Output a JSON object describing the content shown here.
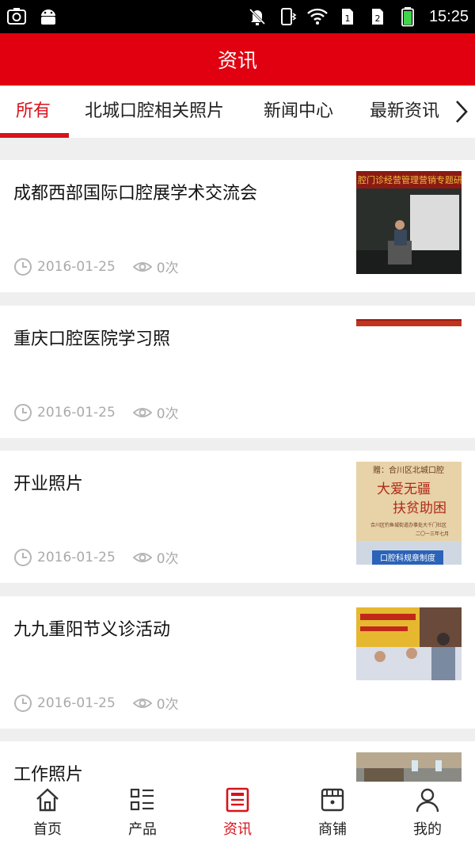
{
  "status_bar": {
    "time": "15:25",
    "icons": [
      "screenshot-icon",
      "android-icon",
      "mute-icon",
      "phone-vibrate-icon",
      "wifi-icon",
      "sim1-icon",
      "sim2-icon",
      "battery-icon"
    ]
  },
  "header": {
    "title": "资讯"
  },
  "tabs": [
    {
      "label": "所有",
      "active": true
    },
    {
      "label": "北城口腔相关照片"
    },
    {
      "label": "新闻中心"
    },
    {
      "label": "最新资讯"
    }
  ],
  "news": [
    {
      "title": "成都西部国际口腔展学术交流会",
      "date": "2016-01-25",
      "views": "0次",
      "thumb": "conference-photo"
    },
    {
      "title": "重庆口腔医院学习照",
      "date": "2016-01-25",
      "views": "0次",
      "thumb": "banner-photo-partial"
    },
    {
      "title": "开业照片",
      "date": "2016-01-25",
      "views": "0次",
      "thumb": "plaque-photo"
    },
    {
      "title": "九九重阳节义诊活动",
      "date": "2016-01-25",
      "views": "0次",
      "thumb": "event-photo"
    },
    {
      "title": "工作照片",
      "date": "",
      "views": "",
      "thumb": "clinic-photo"
    }
  ],
  "thumb_text": {
    "conference_banner": "腔门诊经营管理营销专题研讨",
    "plaque_line1": "赠：合川区北城口腔",
    "plaque_line2": "大爱无疆",
    "plaque_line3": "扶贫助困",
    "plaque_line4": "合川区钓鱼城街道办事处大千门社区",
    "plaque_line5": "二〇一三年七月",
    "plaque_footer": "口腔科规章制度"
  },
  "bottom_nav": [
    {
      "label": "首页",
      "icon": "home-icon"
    },
    {
      "label": "产品",
      "icon": "grid-list-icon"
    },
    {
      "label": "资讯",
      "icon": "news-icon",
      "active": true
    },
    {
      "label": "商铺",
      "icon": "store-icon"
    },
    {
      "label": "我的",
      "icon": "user-icon"
    }
  ],
  "colors": {
    "brand_red": "#e0000f",
    "active_red": "#d8121c",
    "meta_gray": "#aaaaaa"
  }
}
